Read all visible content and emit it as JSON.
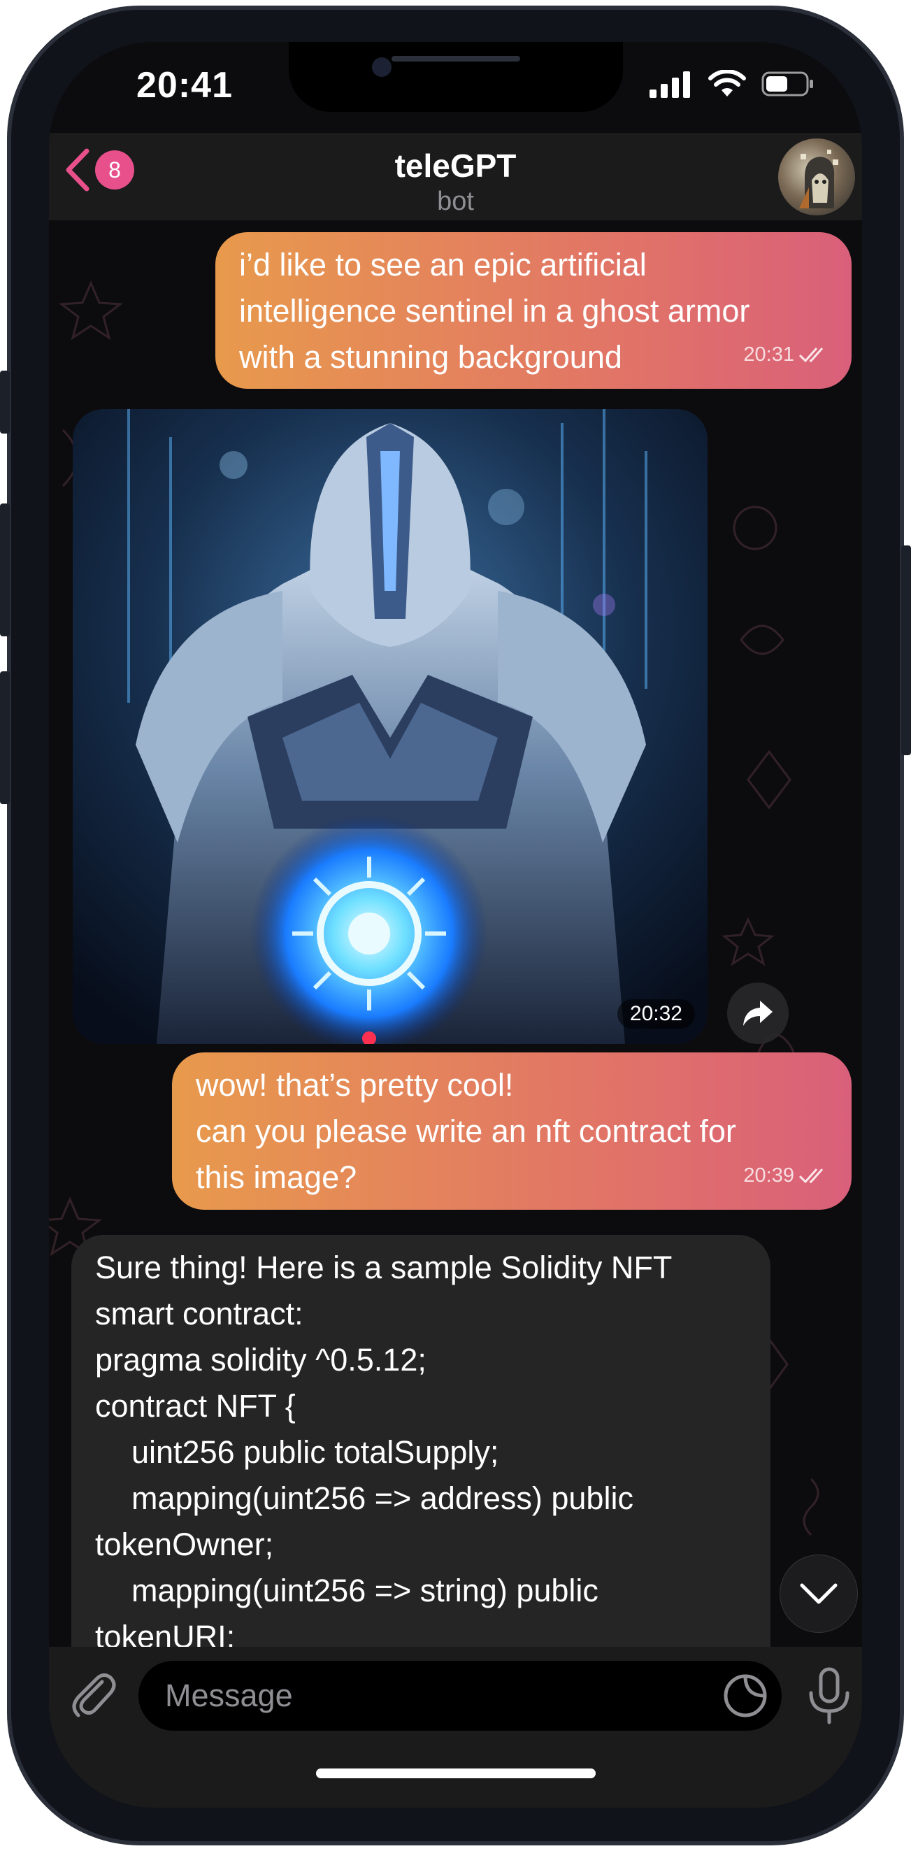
{
  "status_bar": {
    "time": "20:41",
    "icons": [
      "cellular-signal-icon",
      "wifi-icon",
      "battery-icon"
    ]
  },
  "header": {
    "back_icon": "chevron-left-icon",
    "unread_count": "8",
    "title": "teleGPT",
    "subtitle": "bot",
    "avatar_icon": "bot-avatar"
  },
  "messages": [
    {
      "direction": "outgoing",
      "lines": [
        "i’d like to see an epic artificial",
        "intelligence sentinel in a ghost armor",
        "with a stunning background"
      ],
      "time": "20:31",
      "status_icon": "double-check-icon"
    },
    {
      "direction": "incoming",
      "type": "photo",
      "time": "20:32",
      "action_icon": "share-icon"
    },
    {
      "direction": "outgoing",
      "lines": [
        "wow! that’s pretty cool!",
        "can you please write an nft contract for",
        "this image?"
      ],
      "time": "20:39",
      "status_icon": "double-check-icon"
    },
    {
      "direction": "incoming",
      "lines": [
        "Sure thing! Here is a sample Solidity NFT",
        "smart contract:",
        "pragma solidity ^0.5.12;",
        "contract NFT {",
        "uint256 public totalSupply;",
        "mapping(uint256 => address) public",
        "tokenOwner;",
        "mapping(uint256 => string) public",
        "tokenURI;"
      ]
    }
  ],
  "scroll_down_icon": "chevron-down-icon",
  "composer": {
    "attach_icon": "paperclip-icon",
    "placeholder": "Message",
    "sticker_icon": "sticker-icon",
    "mic_icon": "microphone-icon"
  },
  "colors": {
    "accent": "#e8508c",
    "outgoing_gradient_start": "#e89a4c",
    "outgoing_gradient_end": "#d9607a",
    "incoming_bubble": "#252526",
    "background": "#0c0c0e"
  }
}
